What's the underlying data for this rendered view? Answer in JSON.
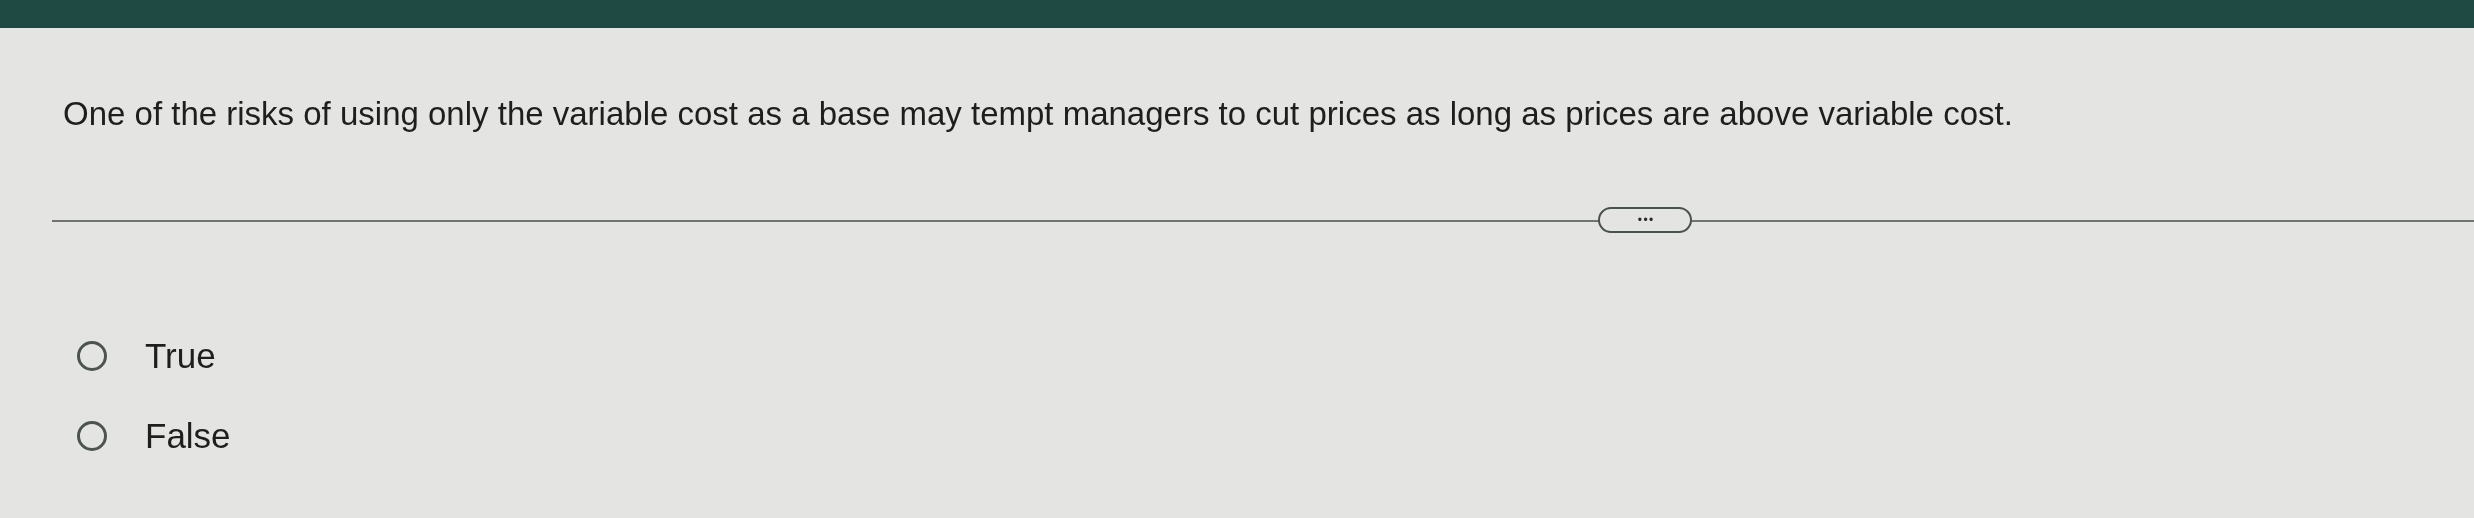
{
  "question": "One of the risks of using only the variable cost as a base may tempt managers to cut prices as long as prices are above variable cost.",
  "expand_button": {
    "label": "• • •"
  },
  "options": [
    {
      "label": "True",
      "selected": false
    },
    {
      "label": "False",
      "selected": false
    }
  ]
}
